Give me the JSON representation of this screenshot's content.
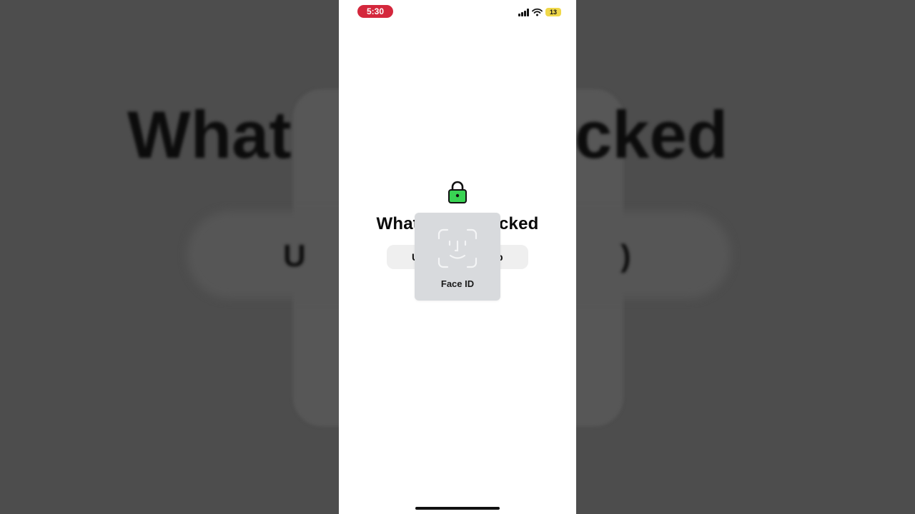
{
  "status_bar": {
    "time": "5:30",
    "battery_level": "13"
  },
  "app": {
    "title_left": "What",
    "title_right": "cked",
    "unlock_left": "U",
    "unlock_right": "p"
  },
  "backdrop": {
    "title_left": "What",
    "title_right": "cked",
    "pill_left": "U",
    "pill_right": ")"
  },
  "face_id": {
    "label": "Face ID"
  },
  "icons": {
    "lock": "lock-icon",
    "face_id": "face-id-icon",
    "signal": "cellular-signal-icon",
    "wifi": "wifi-icon",
    "battery": "battery-icon"
  },
  "colors": {
    "time_pill": "#d4273c",
    "lock_green": "#39d353",
    "battery_yellow": "#f0d84a"
  }
}
